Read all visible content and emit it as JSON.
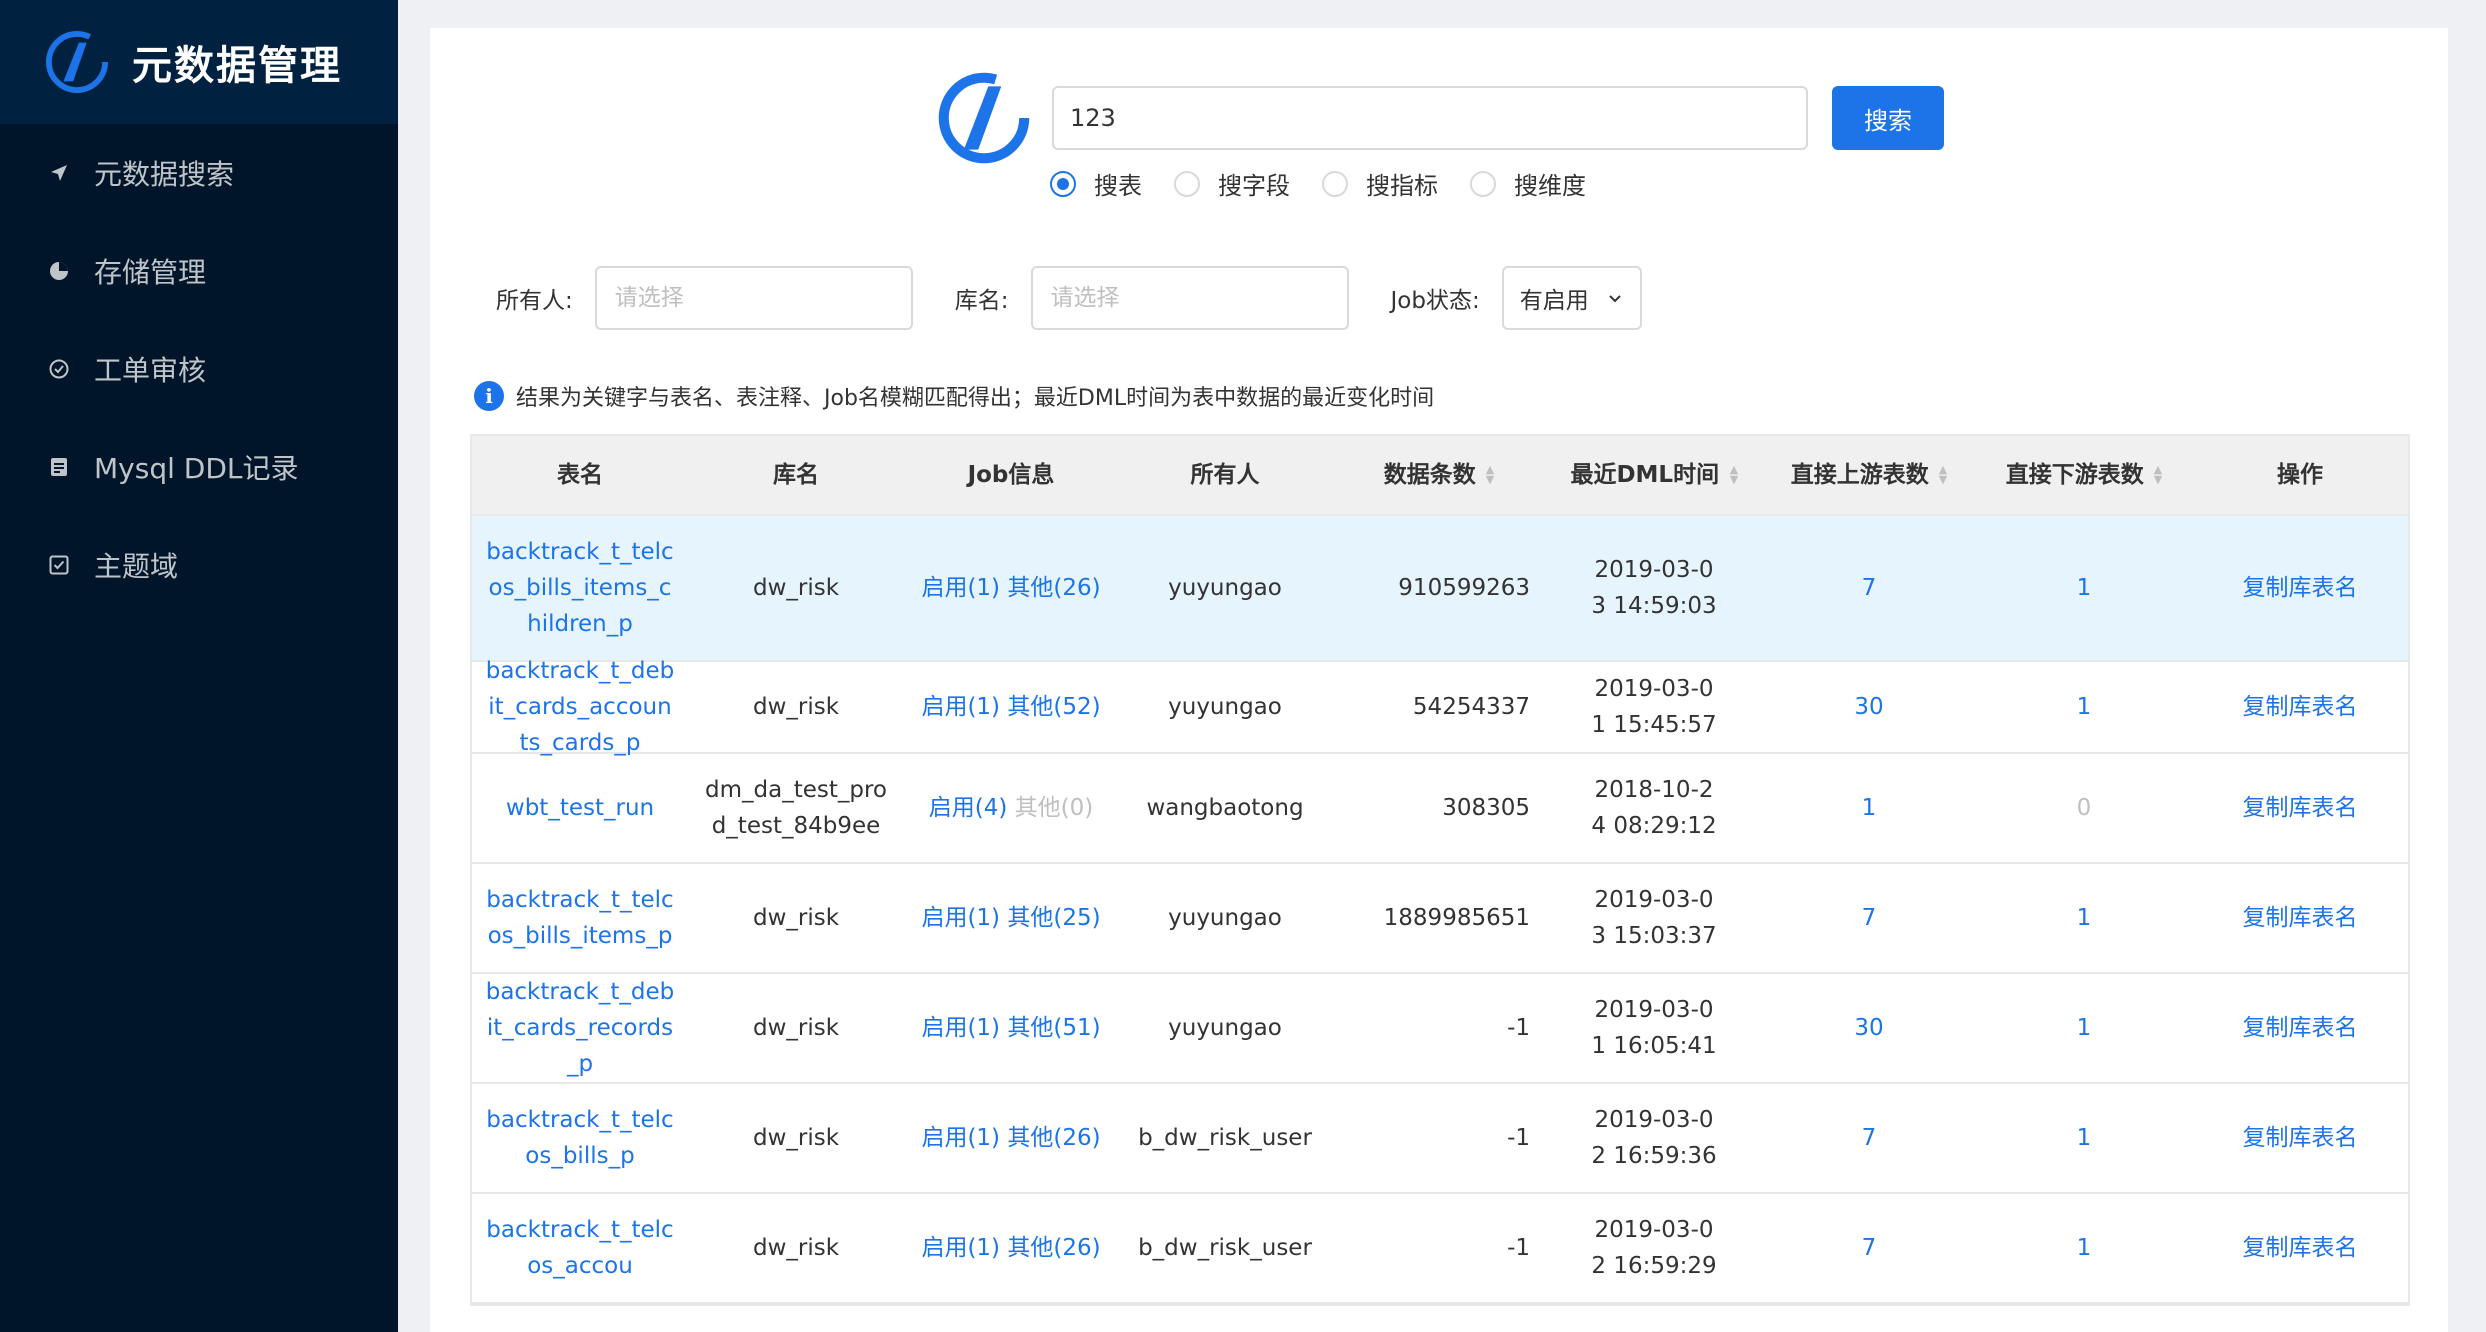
{
  "app": {
    "title": "元数据管理"
  },
  "sidebar": {
    "items": [
      {
        "label": "元数据搜索",
        "icon": "send-icon"
      },
      {
        "label": "存储管理",
        "icon": "pie-chart-icon"
      },
      {
        "label": "工单审核",
        "icon": "check-circle-icon"
      },
      {
        "label": "Mysql DDL记录",
        "icon": "file-icon"
      },
      {
        "label": "主题域",
        "icon": "check-square-icon"
      }
    ]
  },
  "search": {
    "value": "123",
    "button_label": "搜索"
  },
  "search_types": [
    {
      "label": "搜表",
      "checked": true
    },
    {
      "label": "搜字段",
      "checked": false
    },
    {
      "label": "搜指标",
      "checked": false
    },
    {
      "label": "搜维度",
      "checked": false
    }
  ],
  "filters": {
    "owner_label": "所有人:",
    "owner_placeholder": "请选择",
    "db_label": "库名:",
    "db_placeholder": "请选择",
    "job_label": "Job状态:",
    "job_value": "有启用"
  },
  "info_text": "结果为关键字与表名、表注释、Job名模糊匹配得出；最近DML时间为表中数据的最近变化时间",
  "table": {
    "columns": [
      "表名",
      "库名",
      "Job信息",
      "所有人",
      "数据条数",
      "最近DML时间",
      "直接上游表数",
      "直接下游表数",
      "操作"
    ],
    "rows": [
      {
        "name": "backtrack_t_telcos_bills_items_children_p",
        "db": "dw_risk",
        "job_on": "启用(1)",
        "job_other": "其他(26)",
        "other_muted": false,
        "owner": "yuyungao",
        "count": "910599263",
        "dml": "2019-03-03 14:59:03",
        "up": "7",
        "down": "1",
        "down_muted": false,
        "action": "复制库表名",
        "height": 146,
        "highlight": true
      },
      {
        "name": "backtrack_t_debit_cards_accounts_cards_p",
        "db": "dw_risk",
        "job_on": "启用(1)",
        "job_other": "其他(52)",
        "other_muted": false,
        "owner": "yuyungao",
        "count": "54254337",
        "dml": "2019-03-01 15:45:57",
        "up": "30",
        "down": "1",
        "down_muted": false,
        "action": "复制库表名",
        "height": 146,
        "highlight": false
      },
      {
        "name": "wbt_test_run",
        "db": "dm_da_test_prod_test_84b9ee",
        "job_on": "启用(4)",
        "job_other": "其他(0)",
        "other_muted": true,
        "owner": "wangbaotong",
        "count": "308305",
        "dml": "2018-10-24 08:29:12",
        "up": "1",
        "down": "0",
        "down_muted": true,
        "action": "复制库表名",
        "height": 110,
        "highlight": false
      },
      {
        "name": "backtrack_t_telcos_bills_items_p",
        "db": "dw_risk",
        "job_on": "启用(1)",
        "job_other": "其他(25)",
        "other_muted": false,
        "owner": "yuyungao",
        "count": "1889985651",
        "dml": "2019-03-03 15:03:37",
        "up": "7",
        "down": "1",
        "down_muted": false,
        "action": "复制库表名",
        "height": 110,
        "highlight": false
      },
      {
        "name": "backtrack_t_debit_cards_records_p",
        "db": "dw_risk",
        "job_on": "启用(1)",
        "job_other": "其他(51)",
        "other_muted": false,
        "owner": "yuyungao",
        "count": "-1",
        "dml": "2019-03-01 16:05:41",
        "up": "30",
        "down": "1",
        "down_muted": false,
        "action": "复制库表名",
        "height": 110,
        "highlight": false
      },
      {
        "name": "backtrack_t_telcos_bills_p",
        "db": "dw_risk",
        "job_on": "启用(1)",
        "job_other": "其他(26)",
        "other_muted": false,
        "owner": "b_dw_risk_user",
        "count": "-1",
        "dml": "2019-03-02 16:59:36",
        "up": "7",
        "down": "1",
        "down_muted": false,
        "action": "复制库表名",
        "height": 110,
        "highlight": false
      },
      {
        "name": "backtrack_t_telcos_accou",
        "db": "dw_risk",
        "job_on": "启用(1)",
        "job_other": "其他(26)",
        "other_muted": false,
        "owner": "b_dw_risk_user",
        "count": "-1",
        "dml": "2019-03-02 16:59:29",
        "up": "7",
        "down": "1",
        "down_muted": false,
        "action": "复制库表名",
        "height": 110,
        "highlight": false
      }
    ]
  },
  "colors": {
    "sidebar": "#001529",
    "accent": "#1d74e8",
    "highlight_row": "#e6f4fd"
  }
}
